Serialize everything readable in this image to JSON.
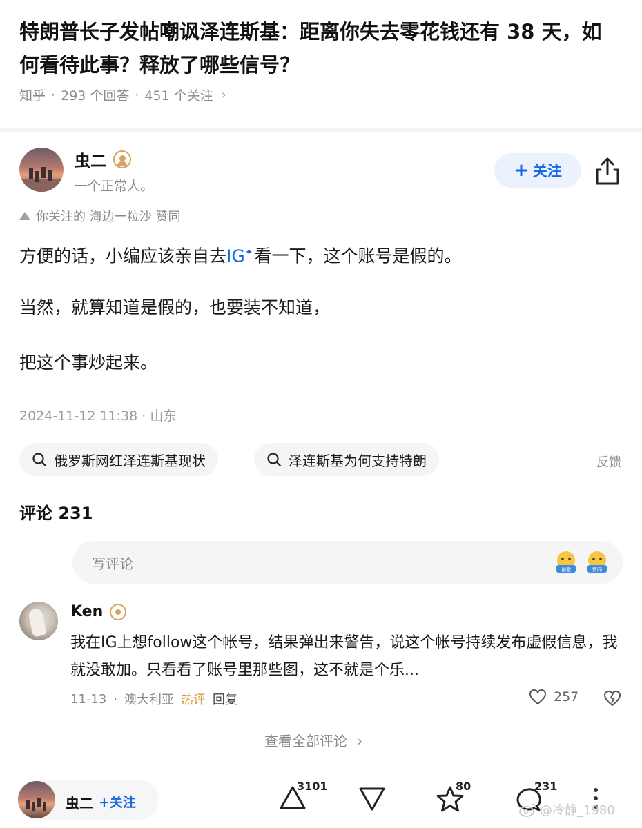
{
  "question": {
    "title": "特朗普长子发帖嘲讽泽连斯基：距离你失去零花钱还有 38 天，如何看待此事？释放了哪些信号？",
    "source": "知乎",
    "answers": "293 个回答",
    "followers": "451 个关注"
  },
  "answer": {
    "author_name": "虫二",
    "author_bio": "一个正常人。",
    "follow_label": "关注",
    "vote_note": "你关注的 海边一粒沙 赞同",
    "p1_before": "方便的话，小编应该亲自去",
    "p1_link": "IG",
    "p1_after": "看一下，这个账号是假的。",
    "p2": "当然，就算知道是假的，也要装不知道，",
    "p3": "把这个事炒起来。",
    "timestamp": "2024-11-12 11:38 · 山东"
  },
  "related_searches": [
    {
      "label": "俄罗斯网红泽连斯基现状"
    },
    {
      "label": "泽连斯基为何支持特朗"
    }
  ],
  "feedback_label": "反馈",
  "comments": {
    "header": "评论 231",
    "input_placeholder": "写评论",
    "emoji_labels": [
      "谢邀",
      "赞同"
    ],
    "top": {
      "author": "Ken",
      "text": "我在IG上想follow这个帐号，结果弹出来警告，说这个帐号持续发布虚假信息，我就没敢加。只看看了账号里那些图，这不就是个乐...",
      "date": "11-13",
      "location": "澳大利亚",
      "hot_label": "热评",
      "reply_label": "回复",
      "likes": "257"
    },
    "view_all": "查看全部评论"
  },
  "bottom_bar": {
    "author_name": "虫二",
    "follow_label": "关注",
    "upvotes": "3101",
    "favorites": "80",
    "comments": "231"
  },
  "watermark": "@冷静_1980",
  "colors": {
    "accent_blue": "#1769e0",
    "hot_orange": "#d99a3d",
    "badge_gold": "#d8a35c"
  }
}
